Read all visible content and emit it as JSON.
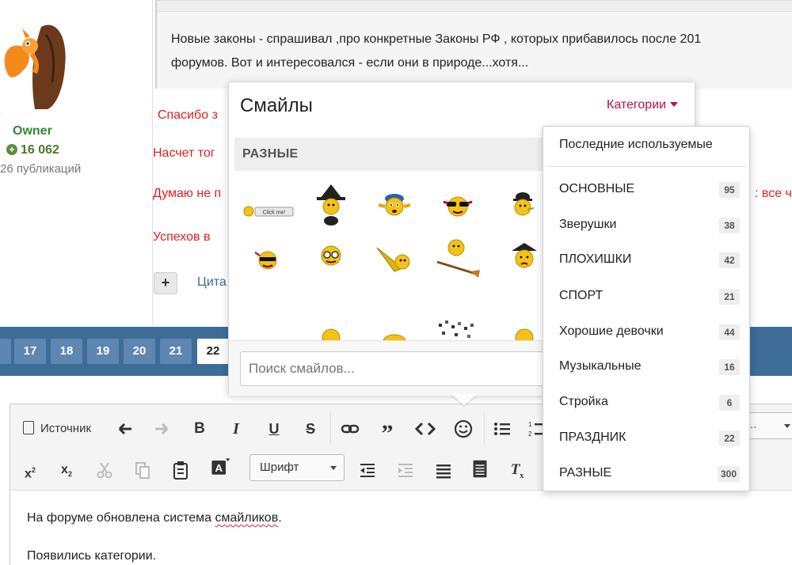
{
  "author": {
    "role": "Owner",
    "reputation": "16 062",
    "posts": "26 публикаций"
  },
  "post": {
    "quote_line1": "Новые законы - спрашивал ,про конкретные Законы РФ , которых прибавилось после 201",
    "quote_line2": "форумов. Вот и интересовался - если они в природе...хотя...",
    "lines": [
      "Спасибо з",
      "Насчет тог",
      "Думаю не п",
      "Успехов  в"
    ],
    "right_fragment": ": все ч",
    "add_label": "+",
    "quote_label": "Цита"
  },
  "pager": {
    "pages": [
      "",
      "17",
      "18",
      "19",
      "20",
      "21",
      "22"
    ],
    "active": "22"
  },
  "editor": {
    "source_label": "Источник",
    "font_label": "Шрифт",
    "right_select": "..",
    "para1_before": "На форуме обновлена система ",
    "para1_misspelled": "смайликов",
    "para1_after": ".",
    "para2": "Появились категории."
  },
  "smiley_popup": {
    "title": "Смайлы",
    "categories_link": "Категории",
    "current_category": "РАЗНЫЕ",
    "search_placeholder": "Поиск смайлов...",
    "click_me": "Click me!"
  },
  "category_menu": {
    "recent": "Последние используемые",
    "items": [
      {
        "name": "ОСНОВНЫЕ",
        "count": "95"
      },
      {
        "name": "Зверушки",
        "count": "38"
      },
      {
        "name": "ПЛОХИШКИ",
        "count": "42"
      },
      {
        "name": "СПОРТ",
        "count": "21"
      },
      {
        "name": "Хорошие девочки",
        "count": "44"
      },
      {
        "name": "Музыкальные",
        "count": "16"
      },
      {
        "name": "Стройка",
        "count": "6"
      },
      {
        "name": "ПРАЗДНИК",
        "count": "22"
      },
      {
        "name": "РАЗНЫЕ",
        "count": "300"
      }
    ]
  },
  "colors": {
    "accent_link": "#b0124f",
    "pager_bg": "#3e6c99",
    "owner_green": "#2e8b2e",
    "post_red": "#e02020"
  }
}
